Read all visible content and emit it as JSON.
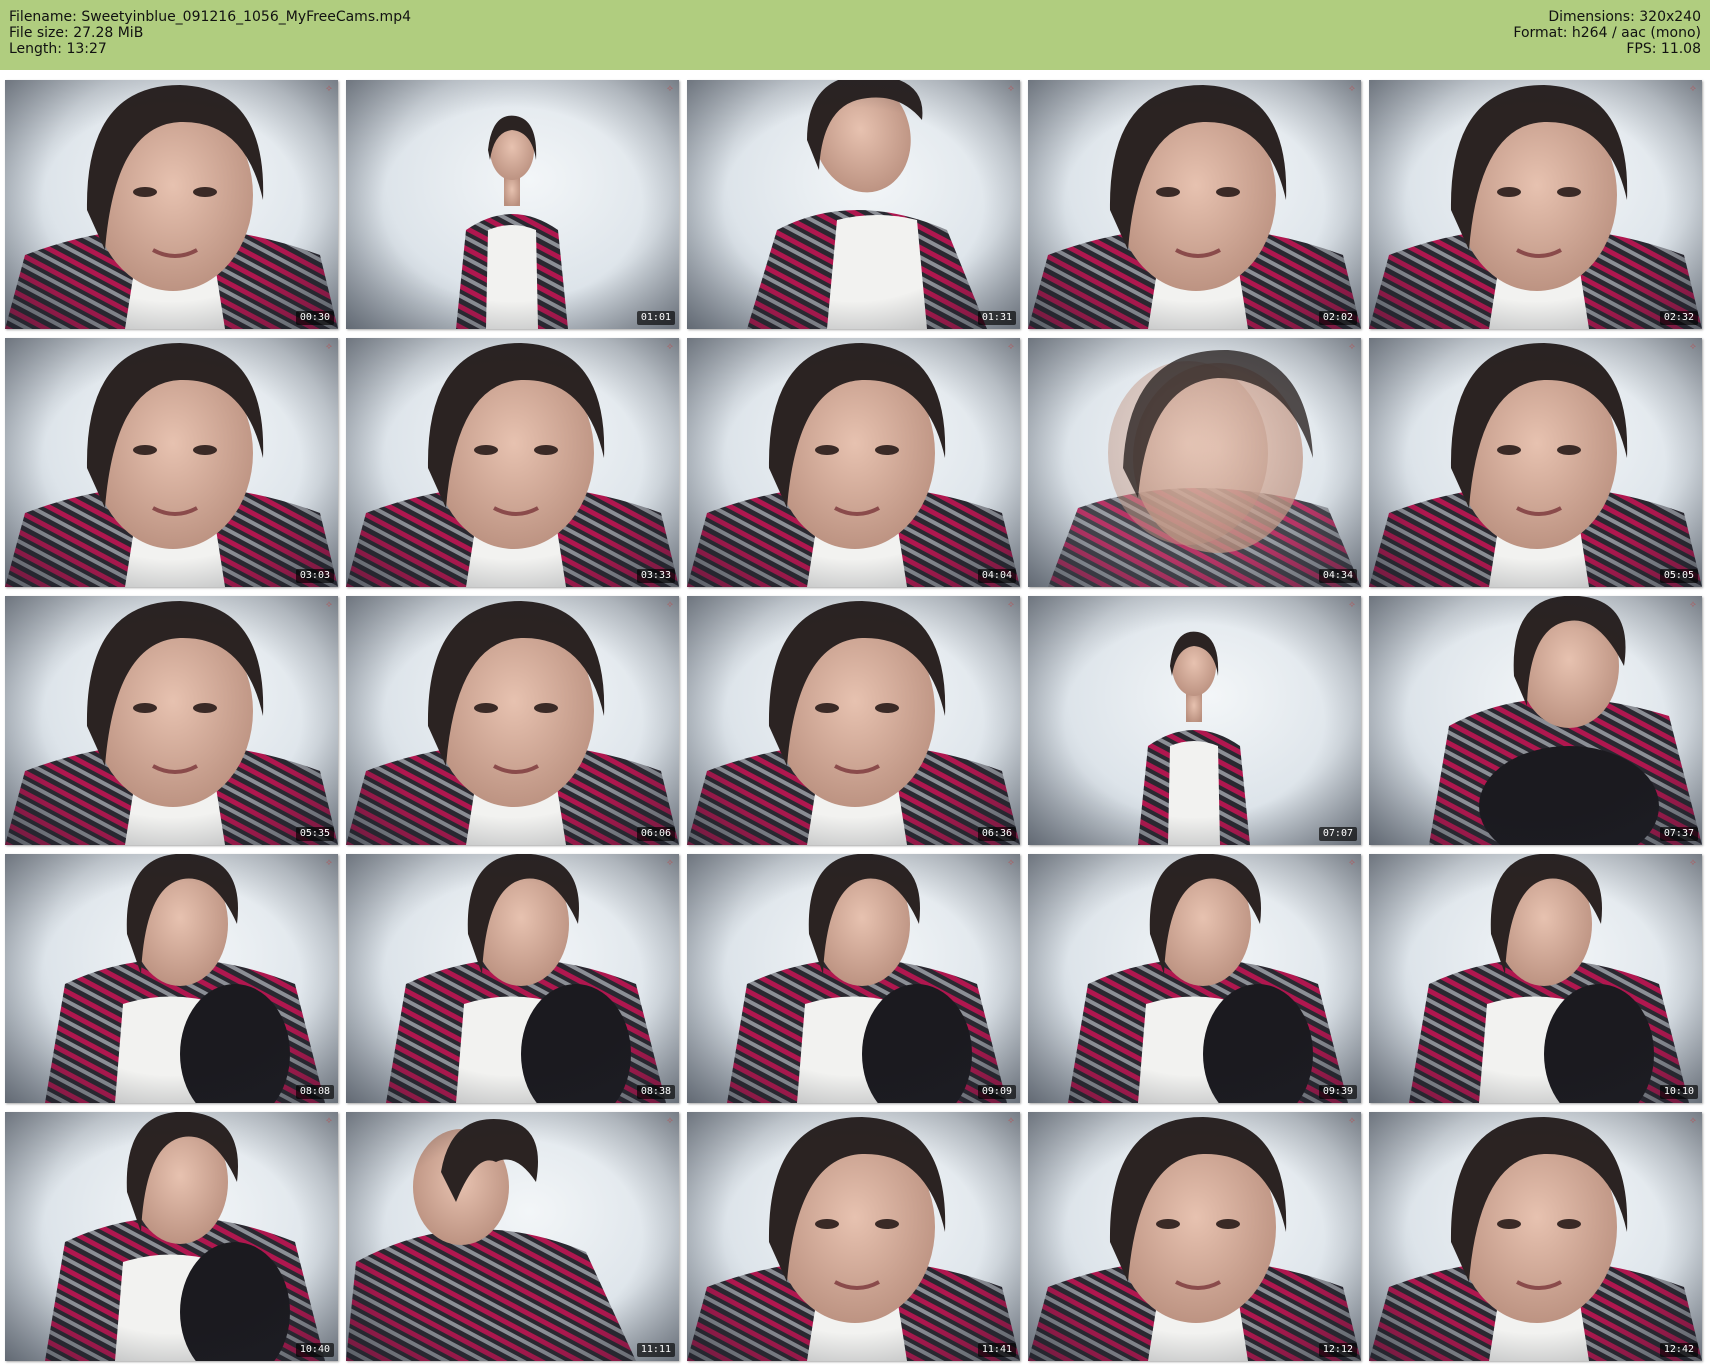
{
  "header": {
    "left": [
      {
        "label": "Filename:",
        "value": "Sweetyinblue_091216_1056_MyFreeCams.mp4"
      },
      {
        "label": "File size:",
        "value": "27.28 MiB"
      },
      {
        "label": "Length:",
        "value": "13:27"
      }
    ],
    "right": [
      {
        "label": "Dimensions:",
        "value": "320x240"
      },
      {
        "label": "Format:",
        "value": "h264 / aac (mono)"
      },
      {
        "label": "FPS:",
        "value": "11.08"
      }
    ]
  },
  "colors": {
    "header_bg": "#b0cd7f",
    "stripe_magenta": "#b0174f",
    "stripe_grey": "#8c8f96",
    "stripe_dark": "#2a2830",
    "top_white": "#f2f2f0"
  },
  "thumbnails": [
    {
      "time": "00:30",
      "scene": "closeup"
    },
    {
      "time": "01:01",
      "scene": "wide"
    },
    {
      "time": "01:31",
      "scene": "tilt"
    },
    {
      "time": "02:02",
      "scene": "closeup"
    },
    {
      "time": "02:32",
      "scene": "closeup"
    },
    {
      "time": "03:03",
      "scene": "closeup"
    },
    {
      "time": "03:33",
      "scene": "closeup"
    },
    {
      "time": "04:04",
      "scene": "closeup"
    },
    {
      "time": "04:34",
      "scene": "blur"
    },
    {
      "time": "05:05",
      "scene": "closeup"
    },
    {
      "time": "05:35",
      "scene": "closeup"
    },
    {
      "time": "06:06",
      "scene": "closeup"
    },
    {
      "time": "06:36",
      "scene": "closeup"
    },
    {
      "time": "07:07",
      "scene": "wide"
    },
    {
      "time": "07:37",
      "scene": "lean"
    },
    {
      "time": "08:08",
      "scene": "seated"
    },
    {
      "time": "08:38",
      "scene": "seated"
    },
    {
      "time": "09:09",
      "scene": "seated"
    },
    {
      "time": "09:39",
      "scene": "seated"
    },
    {
      "time": "10:10",
      "scene": "seated"
    },
    {
      "time": "10:40",
      "scene": "seated"
    },
    {
      "time": "11:11",
      "scene": "profile"
    },
    {
      "time": "11:41",
      "scene": "closeup"
    },
    {
      "time": "12:12",
      "scene": "closeup"
    },
    {
      "time": "12:42",
      "scene": "closeup"
    }
  ]
}
